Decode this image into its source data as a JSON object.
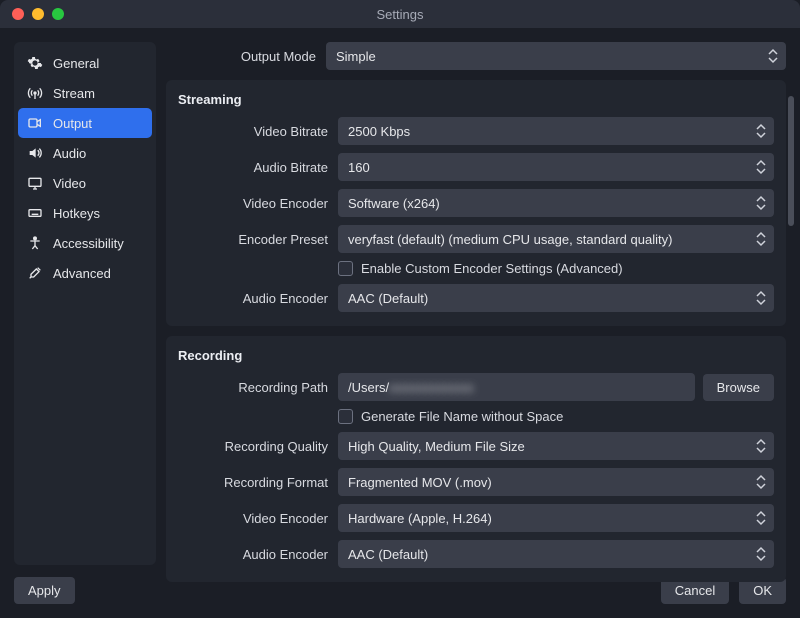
{
  "window": {
    "title": "Settings"
  },
  "sidebar": {
    "items": [
      {
        "label": "General"
      },
      {
        "label": "Stream"
      },
      {
        "label": "Output"
      },
      {
        "label": "Audio"
      },
      {
        "label": "Video"
      },
      {
        "label": "Hotkeys"
      },
      {
        "label": "Accessibility"
      },
      {
        "label": "Advanced"
      }
    ]
  },
  "output_mode": {
    "label": "Output Mode",
    "value": "Simple"
  },
  "streaming": {
    "heading": "Streaming",
    "video_bitrate": {
      "label": "Video Bitrate",
      "value": "2500 Kbps"
    },
    "audio_bitrate": {
      "label": "Audio Bitrate",
      "value": "160"
    },
    "video_encoder": {
      "label": "Video Encoder",
      "value": "Software (x264)"
    },
    "encoder_preset": {
      "label": "Encoder Preset",
      "value": "veryfast (default) (medium CPU usage, standard quality)"
    },
    "custom_encoder": {
      "label": "Enable Custom Encoder Settings (Advanced)",
      "checked": false
    },
    "audio_encoder": {
      "label": "Audio Encoder",
      "value": "AAC (Default)"
    }
  },
  "recording": {
    "heading": "Recording",
    "path": {
      "label": "Recording Path",
      "value": "/Users/",
      "redacted": "xxxxxxxxxxxxx",
      "browse": "Browse"
    },
    "no_space": {
      "label": "Generate File Name without Space",
      "checked": false
    },
    "quality": {
      "label": "Recording Quality",
      "value": "High Quality, Medium File Size"
    },
    "format": {
      "label": "Recording Format",
      "value": "Fragmented MOV (.mov)"
    },
    "video_encoder": {
      "label": "Video Encoder",
      "value": "Hardware (Apple, H.264)"
    },
    "audio_encoder": {
      "label": "Audio Encoder",
      "value": "AAC (Default)"
    }
  },
  "buttons": {
    "apply": "Apply",
    "cancel": "Cancel",
    "ok": "OK"
  }
}
